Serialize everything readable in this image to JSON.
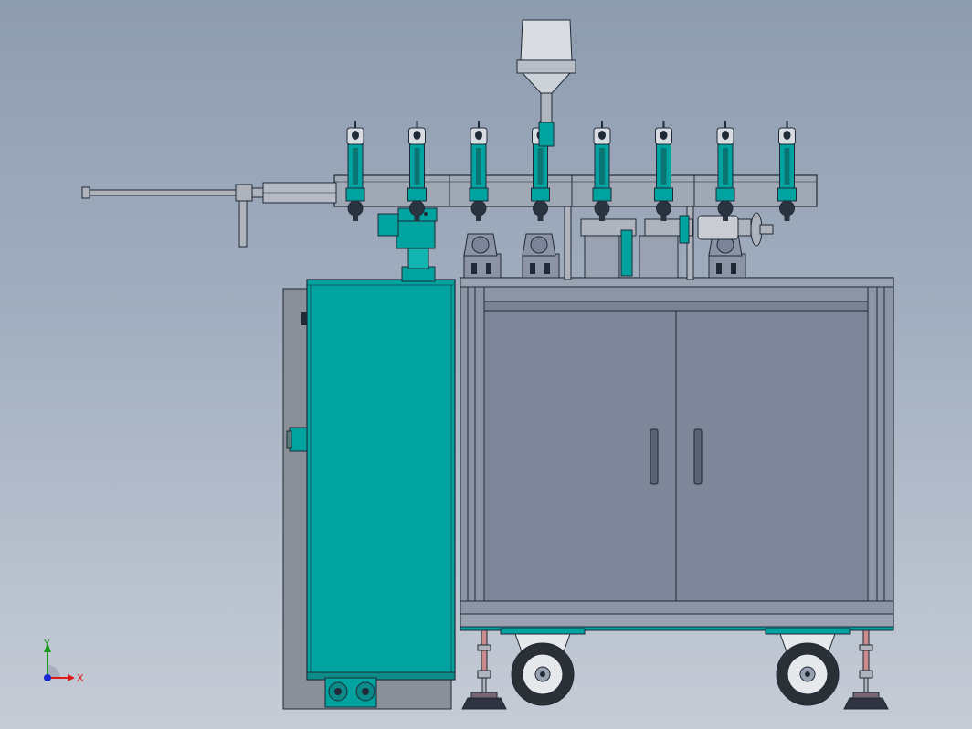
{
  "colors": {
    "background_top": "#8e9cb0",
    "background_bottom": "#c5ccd6",
    "teal": "#00a3a0",
    "cabinet": "#7b8294",
    "frame": "#9aa2b2",
    "steel": "#aeb3bc",
    "outline": "#1f2a36"
  },
  "triad": {
    "x_label": "X",
    "y_label": "Y",
    "x_color": "#e01818",
    "y_color": "#1a9a1a",
    "z_color": "#1a2ad0"
  },
  "parts": {
    "nozzle_count": 8,
    "wheel_count": 2,
    "leveling_foot_count": 2,
    "door_count": 2
  }
}
